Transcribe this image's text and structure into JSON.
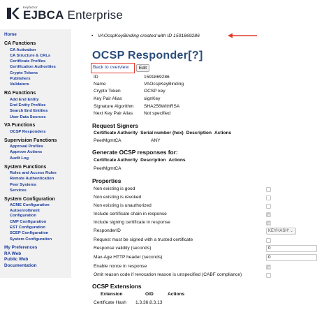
{
  "header": {
    "logo_small": "Keyfactor",
    "logo_brand": "EJBCA",
    "logo_product": " Enterprise"
  },
  "sidebar": {
    "home": "Home",
    "ca_functions": {
      "title": "CA Functions",
      "items": [
        "CA Activation",
        "CA Structure & CRLs",
        "Certificate Profiles",
        "Certification Authorities",
        "Crypto Tokens",
        "Publishers",
        "Validators"
      ]
    },
    "ra_functions": {
      "title": "RA Functions",
      "items": [
        "Add End Entity",
        "End Entity Profiles",
        "Search End Entities",
        "User Data Sources"
      ]
    },
    "va_functions": {
      "title": "VA Functions",
      "items": [
        "OCSP Responders"
      ]
    },
    "supervision_functions": {
      "title": "Supervision Functions",
      "items": [
        "Approval Profiles",
        "Approve Actions",
        "Audit Log"
      ]
    },
    "system_functions": {
      "title": "System Functions",
      "items": [
        "Roles and Access Rules",
        "Remote Authentication",
        "Peer Systems",
        "Services"
      ]
    },
    "system_configuration": {
      "title": "System Configuration",
      "items": [
        "ACME Configuration",
        "Autoenrollment Configuration",
        "CMP Configuration",
        "EST Configuration",
        "SCEP Configuration",
        "System Configuration"
      ]
    },
    "bottom_links": [
      "My Preferences",
      "RA Web",
      "Public Web",
      "Documentation"
    ]
  },
  "main": {
    "info_message": "VAOcspKeyBinding created with ID 1591869286",
    "title": "OCSP Responder",
    "title_help": "[?]",
    "back_link": "Back to overview",
    "edit_button": "Edit",
    "details": [
      {
        "label": "ID",
        "value": "1591869286"
      },
      {
        "label": "Name",
        "value": "VAOcspKeyBinding"
      },
      {
        "label": "Crypto Token",
        "value": "OCSP key"
      },
      {
        "label": "Key Pair Alias",
        "value": "signKey"
      },
      {
        "label": "Signature Algorithm",
        "value": "SHA256WithRSA"
      },
      {
        "label": "Next Key Pair Alias",
        "value": "Not specified"
      }
    ],
    "request_signers": {
      "title": "Request Signers",
      "headers": [
        "Certificate Authority",
        "Serial number (hex)",
        "Description",
        "Actions"
      ],
      "rows": [
        [
          "PeerMgmtCA",
          "ANY",
          "",
          ""
        ]
      ]
    },
    "generate_ocsp": {
      "title": "Generate OCSP responses for:",
      "headers": [
        "Certificate Authority",
        "Description",
        "Actions"
      ],
      "rows": [
        [
          "PeerMgmtCA",
          "",
          ""
        ]
      ]
    },
    "properties": {
      "title": "Properties",
      "items": [
        {
          "label": "Non existing is good",
          "type": "checkbox",
          "checked": false
        },
        {
          "label": "Non existing is revoked",
          "type": "checkbox",
          "checked": false
        },
        {
          "label": "Non existing is unauthorized",
          "type": "checkbox",
          "checked": false
        },
        {
          "label": "Include certificate chain in response",
          "type": "checkbox",
          "checked": true
        },
        {
          "label": "Include signing certificate in response",
          "type": "checkbox",
          "checked": true
        },
        {
          "label": "ResponderID",
          "type": "select",
          "value": "KEYHASH"
        },
        {
          "label": "Request must be signed with a trusted certificate",
          "type": "checkbox",
          "checked": false
        },
        {
          "label": "Response validity (seconds)",
          "type": "number",
          "value": "0"
        },
        {
          "label": "Max-Age HTTP header (seconds)",
          "type": "number",
          "value": "0"
        },
        {
          "label": "Enable nonce in response",
          "type": "checkbox",
          "checked": true
        },
        {
          "label": "Omit reason code if revocation reason is unspecified (CABF compliance)",
          "type": "checkbox",
          "checked": false
        }
      ]
    },
    "ocsp_extensions": {
      "title": "OCSP Extensions",
      "headers": [
        "Extension",
        "OID",
        "Actions"
      ],
      "rows": [
        [
          "Certificate Hash",
          "1.3.36.8.3.13",
          ""
        ]
      ]
    }
  },
  "colors": {
    "link": "#1a3b9c",
    "title": "#2a4d7a",
    "highlight": "#e13a2b",
    "sidebar_bg": "#f1f1f1"
  }
}
